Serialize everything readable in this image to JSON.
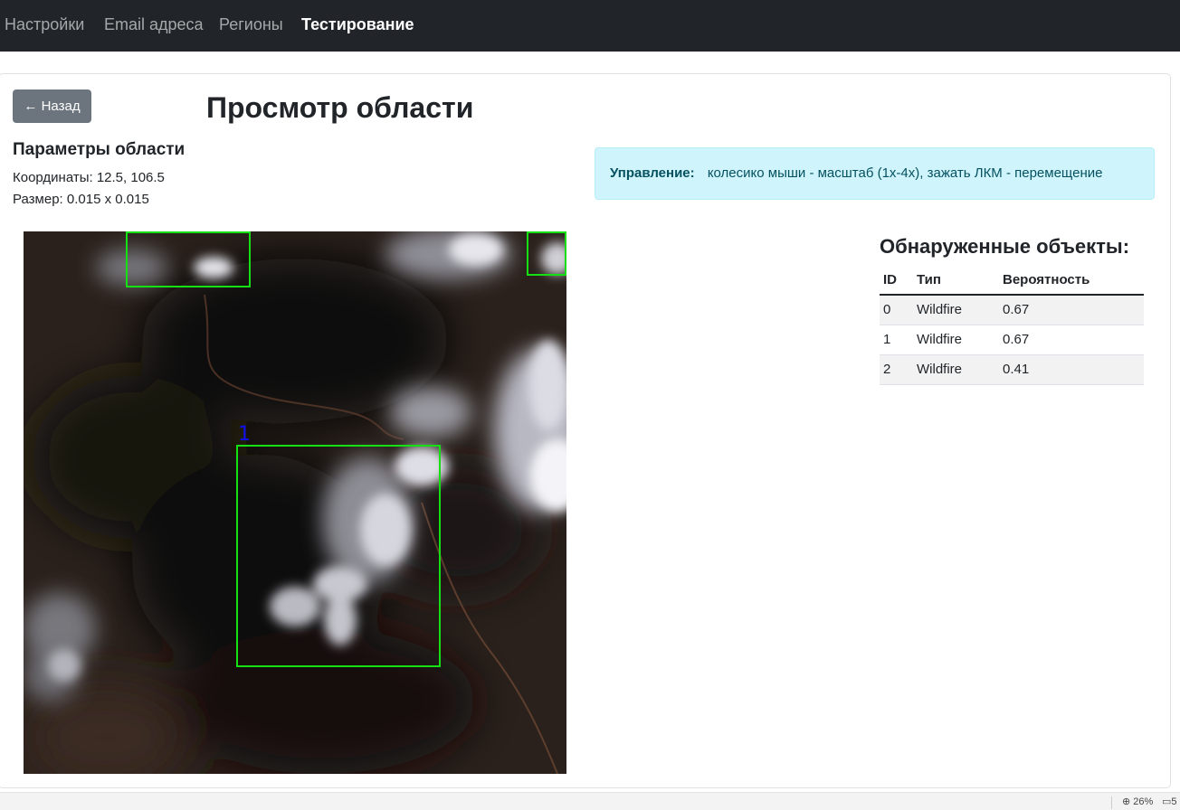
{
  "nav": {
    "items": [
      {
        "label": "Настройки",
        "active": false
      },
      {
        "label": "Email адреса",
        "active": false
      },
      {
        "label": "Регионы",
        "active": false
      },
      {
        "label": "Тестирование",
        "active": true
      }
    ]
  },
  "back_button": {
    "label": "← Назад"
  },
  "page_title": "Просмотр области",
  "params": {
    "title": "Параметры области",
    "coordinates": "Координаты: 12.5, 106.5",
    "size": "Размер: 0.015 x 0.015"
  },
  "alert": {
    "label": "Управление:",
    "text": "колесико мыши - масштаб (1x-4x), зажать ЛКМ - перемещение"
  },
  "image": {
    "box_color": "#14e014",
    "label_color": "#1010ee",
    "visible_label": "1"
  },
  "objects": {
    "title": "Обнаруженные объекты:",
    "columns": [
      "ID",
      "Тип",
      "Вероятность"
    ],
    "rows": [
      {
        "id": "0",
        "type": "Wildfire",
        "probability": "0.67"
      },
      {
        "id": "1",
        "type": "Wildfire",
        "probability": "0.67"
      },
      {
        "id": "2",
        "type": "Wildfire",
        "probability": "0.41"
      }
    ]
  },
  "status_bar": {
    "zoom": "26%",
    "extra": "5"
  }
}
